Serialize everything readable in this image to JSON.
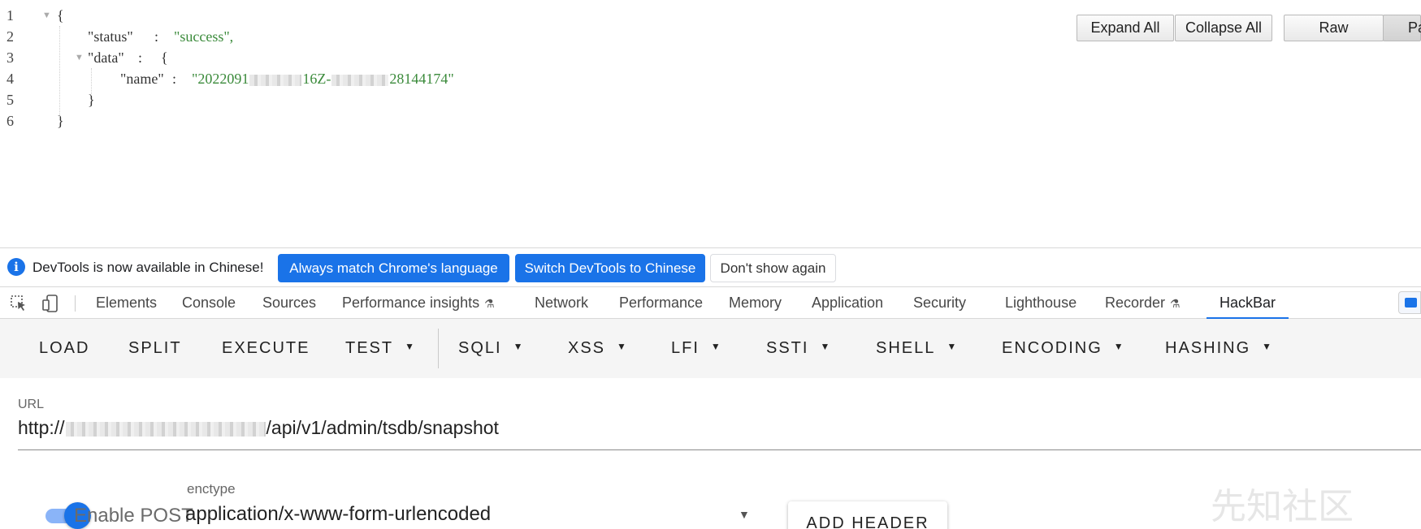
{
  "json_viewer": {
    "line_numbers": [
      "1",
      "2",
      "3",
      "4",
      "5",
      "6"
    ],
    "lines": {
      "l1": {
        "brace": "{"
      },
      "l2": {
        "key": "\"status\"",
        "colon": ":",
        "value": "\"success\",",
        "comma": ""
      },
      "l3": {
        "key": "\"data\"",
        "colon": ":",
        "brace": "{"
      },
      "l4": {
        "key": "\"name\"",
        "colon": ":",
        "value_start": "\"2022091",
        "value_mid": "16Z-",
        "value_end": "28144174\""
      },
      "l5": {
        "brace": "}"
      },
      "l6": {
        "brace": "}"
      }
    },
    "buttons": {
      "expand_all": "Expand All",
      "collapse_all": "Collapse All",
      "raw": "Raw",
      "parsed": "Pa"
    }
  },
  "devtools": {
    "notice": {
      "text": "DevTools is now available in Chinese!",
      "always_match": "Always match Chrome's language",
      "switch": "Switch DevTools to Chinese",
      "dont_show": "Don't show again"
    },
    "tabs": {
      "elements": "Elements",
      "console": "Console",
      "sources": "Sources",
      "performance_insights": "Performance insights",
      "network": "Network",
      "performance": "Performance",
      "memory": "Memory",
      "application": "Application",
      "security": "Security",
      "lighthouse": "Lighthouse",
      "recorder": "Recorder",
      "hackbar": "HackBar"
    }
  },
  "hackbar": {
    "toolbar": {
      "load": "LOAD",
      "split": "SPLIT",
      "execute": "EXECUTE",
      "test": "TEST",
      "sqli": "SQLI",
      "xss": "XSS",
      "lfi": "LFI",
      "ssti": "SSTI",
      "shell": "SHELL",
      "encoding": "ENCODING",
      "hashing": "HASHING"
    },
    "url": {
      "label": "URL",
      "prefix": "http://",
      "path": "/api/v1/admin/tsdb/snapshot"
    },
    "post": {
      "toggle_on": true,
      "enable_label": "Enable POST",
      "enctype_label": "enctype",
      "enctype_value": "application/x-www-form-urlencoded",
      "add_header": "ADD HEADER"
    }
  },
  "watermark": "先知社区",
  "colors": {
    "accent": "#1a73e8",
    "json_string": "#3a8a3a"
  }
}
